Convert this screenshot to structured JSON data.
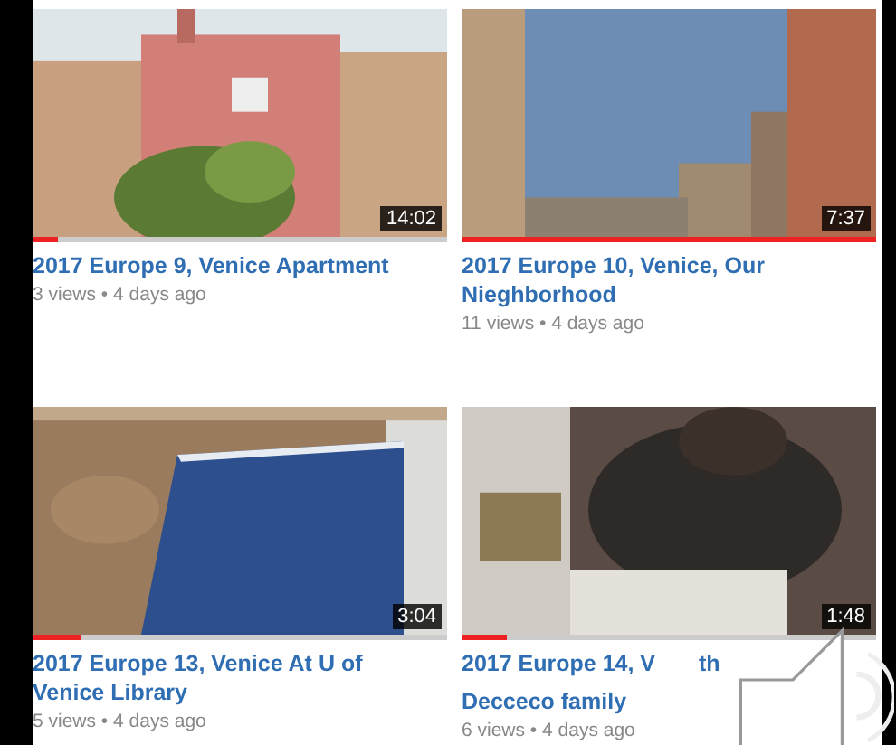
{
  "videos": [
    {
      "duration": "14:02",
      "watched": {
        "level": 0.06
      },
      "title": "2017 Europe 9, Venice Apartment",
      "meta": "3 views • 4 days ago"
    },
    {
      "duration": "7:37",
      "watched": {
        "level": 1
      },
      "title": "2017 Europe 10, Venice, Our Nieghborhood",
      "meta": "11 views • 4 days ago"
    },
    {
      "duration": "3:04",
      "watched": {
        "level": 0.12
      },
      "title": "2017 Europe 13, Venice At U of Venice Library",
      "meta": "5 views • 4 days ago"
    },
    {
      "duration": "1:48",
      "watched": {
        "level": 0.11
      },
      "title": "2017 Europe 14, V",
      "title_end": "th",
      "title_line_2": "Decceco family",
      "meta": "6 views • 4 days ago"
    }
  ]
}
